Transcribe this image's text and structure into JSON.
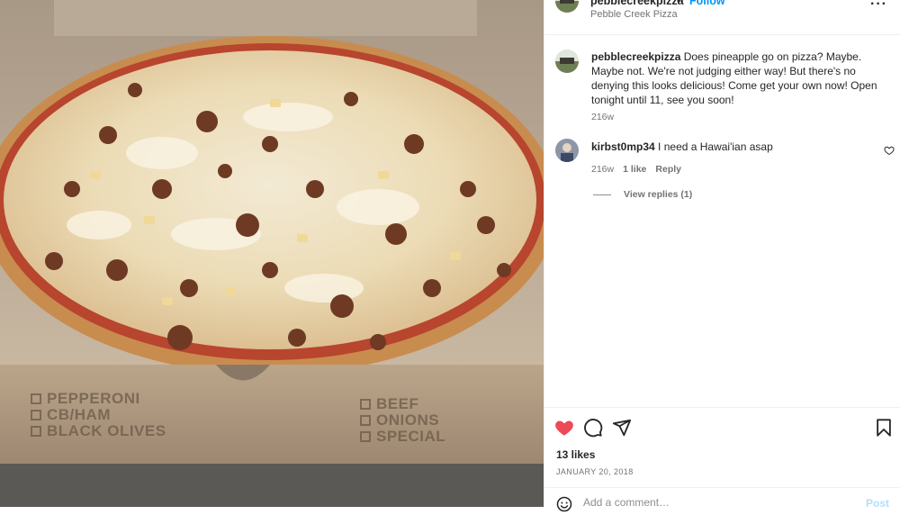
{
  "post": {
    "username": "pebblecreekpizza",
    "follow_label": "Follow",
    "location": "Pebble Creek Pizza",
    "caption": "Does pineapple go on pizza? Maybe. Maybe not. We're not judging either way! But there's no denying this looks delicious! Come get your own now! Open tonight until 11, see you soon!",
    "caption_age": "216w",
    "likes": "13 likes",
    "date": "JANUARY 20, 2018",
    "liked": true,
    "colors": {
      "accent": "#0095f6",
      "like": "#ed4956",
      "secondary_text": "#737373"
    }
  },
  "photo": {
    "box_left_lines": [
      "PEPPERONI",
      "CB/HAM",
      "BLACK OLIVES"
    ],
    "box_right_lines": [
      "BEEF",
      "ONIONS",
      "SPECIAL"
    ]
  },
  "comments": [
    {
      "username": "kirbst0mp34",
      "text": "I need a Hawai'ian asap",
      "age": "216w",
      "likes": "1 like",
      "reply_label": "Reply",
      "view_replies": "View replies (1)"
    }
  ],
  "composer": {
    "placeholder": "Add a comment…",
    "post_label": "Post"
  },
  "icons": {
    "header_more": "more-horizontal-icon",
    "like": "heart-filled-icon",
    "comment": "comment-bubble-icon",
    "share": "paper-plane-icon",
    "save": "bookmark-icon",
    "comment_like": "heart-outline-icon",
    "emoji": "emoji-smile-icon"
  }
}
